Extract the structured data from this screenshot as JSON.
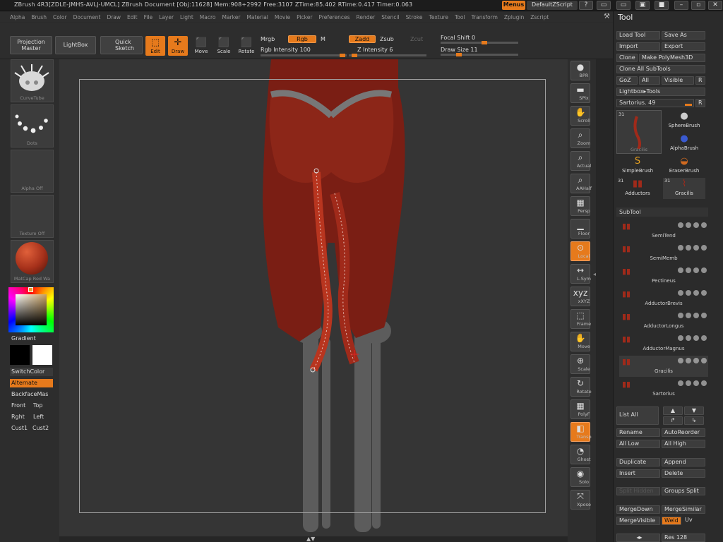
{
  "titlebar": {
    "text": "ZBrush 4R3[ZDLE-JMHS-AVLJ-UMCL]   ZBrush Document   [Obj:11628] Mem:908+2992 Free:3107 ZTime:85.402 RTime:0.417 Timer:0.063",
    "menus": "Menus",
    "default_script": "DefaultZScript"
  },
  "menubar": [
    "Alpha",
    "Brush",
    "Color",
    "Document",
    "Draw",
    "Edit",
    "File",
    "Layer",
    "Light",
    "Macro",
    "Marker",
    "Material",
    "Movie",
    "Picker",
    "Preferences",
    "Render",
    "Stencil",
    "Stroke",
    "Texture",
    "Tool",
    "Transform",
    "Zplugin",
    "Zscript"
  ],
  "toolbar": {
    "projection_master": "Projection\nMaster",
    "lightbox": "LightBox",
    "quick_sketch": "Quick\nSketch",
    "edit": "Edit",
    "draw": "Draw",
    "move": "Move",
    "scale": "Scale",
    "rotate": "Rotate",
    "mrgb": "Mrgb",
    "rgb": "Rgb",
    "m": "M",
    "rgb_intensity": "Rgb Intensity 100",
    "zadd": "Zadd",
    "zsub": "Zsub",
    "zcut": "Zcut",
    "z_intensity": "Z Intensity 6",
    "focal_shift": "Focal Shift 0",
    "draw_size": "Draw Size 11"
  },
  "left_shelf": {
    "brush_caption": "CurveTube",
    "stroke_caption": "Dots",
    "alpha_caption": "Alpha Off",
    "texture_caption": "Texture Off",
    "material_caption": "MatCap Red Wa",
    "gradient": "Gradient",
    "switch_color": "SwitchColor",
    "alternate": "Alternate",
    "backface": "BackfaceMas",
    "front": "Front",
    "top": "Top",
    "rght": "Rght",
    "left": "Left",
    "cust1": "Cust1",
    "cust2": "Cust2"
  },
  "right_shelf": [
    {
      "label": "BPR",
      "icon": "sphere-icon"
    },
    {
      "label": "SPix",
      "icon": "spix-icon"
    },
    {
      "label": "Scroll",
      "icon": "hand-icon"
    },
    {
      "label": "Zoom",
      "icon": "magnify-icon"
    },
    {
      "label": "Actual",
      "icon": "magnify-icon"
    },
    {
      "label": "AAHalf",
      "icon": "magnify-icon"
    },
    {
      "label": "Persp",
      "icon": "grid-icon"
    },
    {
      "label": "Floor",
      "icon": "floor-icon"
    },
    {
      "label": "Local",
      "icon": "local-icon"
    },
    {
      "label": "L.Sym",
      "icon": "sym-icon"
    },
    {
      "label": "xXYZ",
      "icon": "xyz-icon"
    },
    {
      "label": "Frame",
      "icon": "frame-icon"
    },
    {
      "label": "Move",
      "icon": "hand-icon"
    },
    {
      "label": "Scale",
      "icon": "scale-icon"
    },
    {
      "label": "Rotate",
      "icon": "rotate-icon"
    },
    {
      "label": "PolyF",
      "icon": "polyf-icon"
    },
    {
      "label": "Transp",
      "icon": "transp-icon"
    },
    {
      "label": "Ghost",
      "icon": "ghost-icon"
    },
    {
      "label": "Solo",
      "icon": "solo-icon"
    },
    {
      "label": "Xpose",
      "icon": "xpose-icon"
    }
  ],
  "tool_panel": {
    "title": "Tool",
    "load_tool": "Load Tool",
    "save_as": "Save As",
    "import": "Import",
    "export": "Export",
    "clone": "Clone",
    "make_polymesh": "Make PolyMesh3D",
    "clone_all": "Clone All SubTools",
    "goz": "GoZ",
    "all": "All",
    "visible": "Visible",
    "r": "R",
    "lightbox_tools": "Lightbox▸Tools",
    "current_tool": "Sartorius. 49",
    "brushes": [
      {
        "name": "Gracilis",
        "count": "31"
      },
      {
        "name": "SphereBrush"
      },
      {
        "name": "AlphaBrush"
      },
      {
        "name": "SimpleBrush"
      },
      {
        "name": "EraserBrush"
      },
      {
        "name": "Adductors",
        "count": "31"
      },
      {
        "name": "Gracilis",
        "count": "31"
      }
    ],
    "subtool_header": "SubTool",
    "subtools": [
      "SemiTend",
      "SemiMemb",
      "Pectineus",
      "AdductorBrevis",
      "AdductorLongus",
      "AdductorMagnus",
      "Gracilis",
      "Sartorius"
    ],
    "list_all": "List All",
    "rename": "Rename",
    "auto_reorder": "AutoReorder",
    "all_low": "All Low",
    "all_high": "All High",
    "duplicate": "Duplicate",
    "append": "Append",
    "insert": "Insert",
    "delete": "Delete",
    "split_hidden": "Split Hidden",
    "groups_split": "Groups Split",
    "merge_down": "MergeDown",
    "merge_similar": "MergeSimilar",
    "merge_visible": "MergeVisible",
    "weld": "Weld",
    "uv": "Uv",
    "res": "Res 128"
  }
}
